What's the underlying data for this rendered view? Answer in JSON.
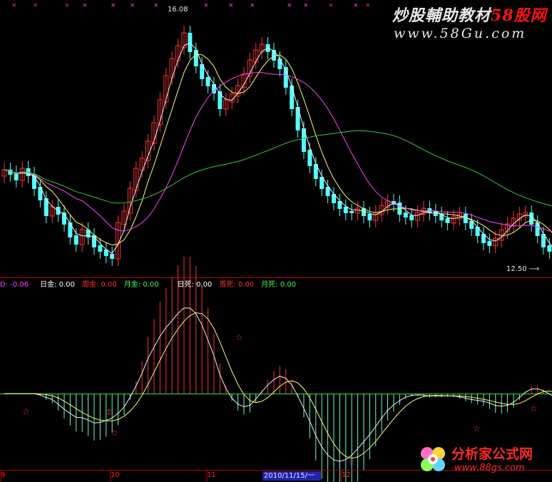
{
  "watermark": {
    "line1_pre": "炒股輔助教材",
    "line1_hl": "58股网",
    "line2": "www.58Gu.com"
  },
  "price_chart": {
    "high_label": "16.08",
    "low_label": "12.50"
  },
  "indicator_bar": {
    "items": [
      {
        "label": "D:",
        "value": "-0.06",
        "color": "#ff40ff"
      },
      {
        "label": "日金:",
        "value": "0.00",
        "color": "#ffffff"
      },
      {
        "label": "周金:",
        "value": "0.00",
        "color": "#ff3030"
      },
      {
        "label": "月金:",
        "value": "0.00",
        "color": "#40ff40"
      },
      {
        "label": "日死:",
        "value": "0.00",
        "color": "#ffffff"
      },
      {
        "label": "周死:",
        "value": "0.00",
        "color": "#ff3030"
      },
      {
        "label": "月死:",
        "value": "0.00",
        "color": "#40ff40"
      }
    ]
  },
  "x_axis": {
    "labels": [
      "9",
      "10",
      "11",
      "12"
    ],
    "cursor_date": "2010/11/15/一"
  },
  "logo2": {
    "title": "分析家公式网",
    "url": "www.88gs.com"
  },
  "colors": {
    "up": "#ff3232",
    "down": "#54ffff",
    "ma_white": "#f0f0f0",
    "ma_yellow": "#ffff66",
    "ma_magenta": "#ff44ff",
    "ma_green": "#33cc33",
    "divider": "#b00000"
  }
}
